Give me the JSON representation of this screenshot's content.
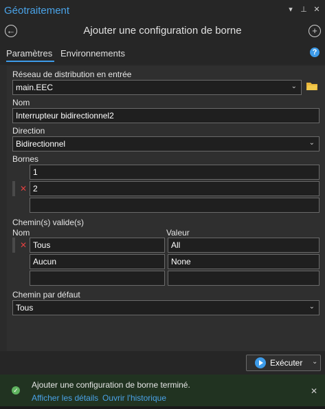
{
  "window": {
    "title": "Géotraitement"
  },
  "header": {
    "tool_title": "Ajouter une configuration de borne"
  },
  "tabs": [
    {
      "label": "Paramètres",
      "active": true
    },
    {
      "label": "Environnements",
      "active": false
    }
  ],
  "params": {
    "network": {
      "label": "Réseau de distribution en entrée",
      "value": "main.EEC"
    },
    "name": {
      "label": "Nom",
      "value": "Interrupteur bidirectionnel2"
    },
    "direction": {
      "label": "Direction",
      "value": "Bidirectionnel"
    },
    "terminals": {
      "label": "Bornes",
      "rows": [
        "1",
        "2",
        ""
      ]
    },
    "paths": {
      "label": "Chemin(s) valide(s)",
      "col_name": "Nom",
      "col_value": "Valeur",
      "rows": [
        {
          "name": "Tous",
          "value": "All"
        },
        {
          "name": "Aucun",
          "value": "None"
        },
        {
          "name": "",
          "value": ""
        }
      ]
    },
    "default_path": {
      "label": "Chemin par défaut",
      "value": "Tous"
    }
  },
  "run": {
    "label": "Exécuter"
  },
  "notification": {
    "message": "Ajouter une configuration de borne terminé.",
    "link_details": "Afficher les détails",
    "link_history": "Ouvrir l'historique",
    "status": "success"
  },
  "icons": {
    "back": "back-arrow-icon",
    "add": "add-icon",
    "help": "help-icon",
    "folder": "folder-icon",
    "dropdown": "chevron-down-icon",
    "delete": "delete-row-icon",
    "pin": "pin-icon",
    "close": "close-icon",
    "menu": "window-menu-icon",
    "success": "check-icon"
  },
  "colors": {
    "accent": "#3d9be9",
    "success_bg": "#213321",
    "delete": "#e04040"
  }
}
